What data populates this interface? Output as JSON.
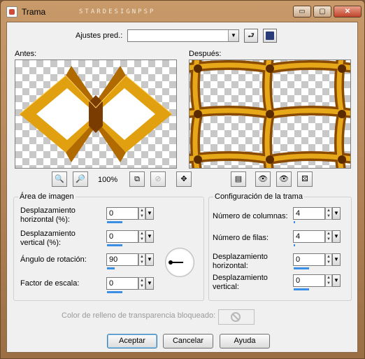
{
  "window": {
    "title": "Trama",
    "watermark": "STARDESIGNPSP"
  },
  "titlebar_buttons": {
    "minimize": "▭",
    "maximize": "▢",
    "close": "✕"
  },
  "presets": {
    "label": "Ajustes pred.:",
    "value": ""
  },
  "preview": {
    "before_label": "Antes:",
    "after_label": "Después:",
    "zoom_text": "100%"
  },
  "image_area": {
    "title": "Área de imagen",
    "fields": [
      {
        "label_line1": "Desplazamiento",
        "label_line2": "horizontal (%):",
        "value": "0",
        "fill": 0.5
      },
      {
        "label_line1": "Desplazamiento",
        "label_line2": "vertical (%):",
        "value": "0",
        "fill": 0.5
      },
      {
        "label_line1": "Ángulo de rotación:",
        "label_line2": "",
        "value": "90",
        "fill": 0.25
      },
      {
        "label_line1": "Factor de escala:",
        "label_line2": "",
        "value": "0",
        "fill": 0.5
      }
    ]
  },
  "pattern_config": {
    "title": "Configuración de la trama",
    "fields": [
      {
        "label_line1": "Número de columnas:",
        "label_line2": "",
        "value": "4",
        "fill": 0.05
      },
      {
        "label_line1": "Número de filas:",
        "label_line2": "",
        "value": "4",
        "fill": 0.05
      },
      {
        "label_line1": "Desplazamiento",
        "label_line2": "horizontal:",
        "value": "0",
        "fill": 0.5
      },
      {
        "label_line1": "Desplazamiento",
        "label_line2": "vertical:",
        "value": "0",
        "fill": 0.5
      }
    ]
  },
  "transparency": {
    "label": "Color de relleno de transparencia bloqueado:"
  },
  "buttons": {
    "ok": "Aceptar",
    "cancel": "Cancelar",
    "help": "Ayuda"
  },
  "colors": {
    "accent_blue": "#3a8ee6",
    "gold": "#e0a010",
    "dark_gold": "#8a4a00"
  }
}
